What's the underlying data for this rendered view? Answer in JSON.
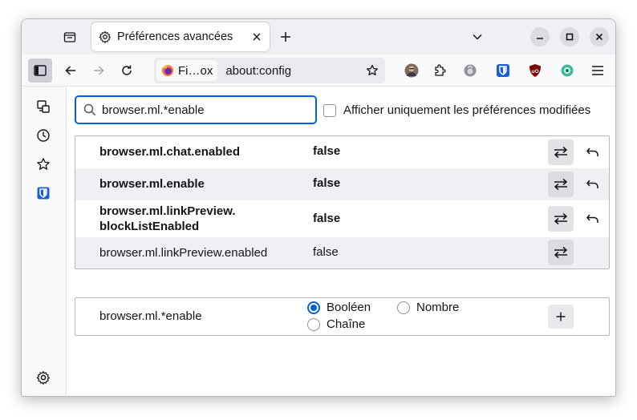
{
  "tab": {
    "title": "Préférences avancées"
  },
  "urlbar": {
    "identity_label": "Fi…ox",
    "url": "about:config"
  },
  "search": {
    "value": "browser.ml.*enable",
    "placeholder": ""
  },
  "modified_only": {
    "label": "Afficher uniquement les préférences modifiées",
    "checked": false
  },
  "prefs": [
    {
      "name": "browser.ml.chat.enabled",
      "value": "false",
      "modified": true
    },
    {
      "name": "browser.ml.enable",
      "value": "false",
      "modified": true
    },
    {
      "name_line1": "browser.ml.linkPreview.",
      "name_line2": "blockListEnabled",
      "value": "false",
      "modified": true
    },
    {
      "name": "browser.ml.linkPreview.enabled",
      "value": "false",
      "modified": false
    }
  ],
  "new_pref": {
    "name": "browser.ml.*enable",
    "types": {
      "boolean": "Booléen",
      "number": "Nombre",
      "string": "Chaîne"
    },
    "selected": "boolean"
  },
  "icons": {
    "tab_list": "tab-list-icon",
    "settings": "gear-icon",
    "close": "close-icon",
    "new_tab": "plus-icon",
    "list_all_tabs": "chevron-down-icon",
    "minimize": "minimize-icon",
    "maximize": "maximize-icon",
    "close_window": "close-window-icon",
    "sidebar": "sidebar-icon",
    "back": "back-arrow-icon",
    "forward": "forward-arrow-icon",
    "reload": "reload-icon",
    "firefox": "firefox-icon",
    "bookmark": "star-icon",
    "account": "avatar",
    "extensions": "puzzle-icon",
    "toggle": "toggle-arrows-icon",
    "reset": "undo-icon"
  },
  "colors": {
    "accent": "#0061e0",
    "bitwarden": "#175ddc",
    "ublock": "#800000"
  }
}
